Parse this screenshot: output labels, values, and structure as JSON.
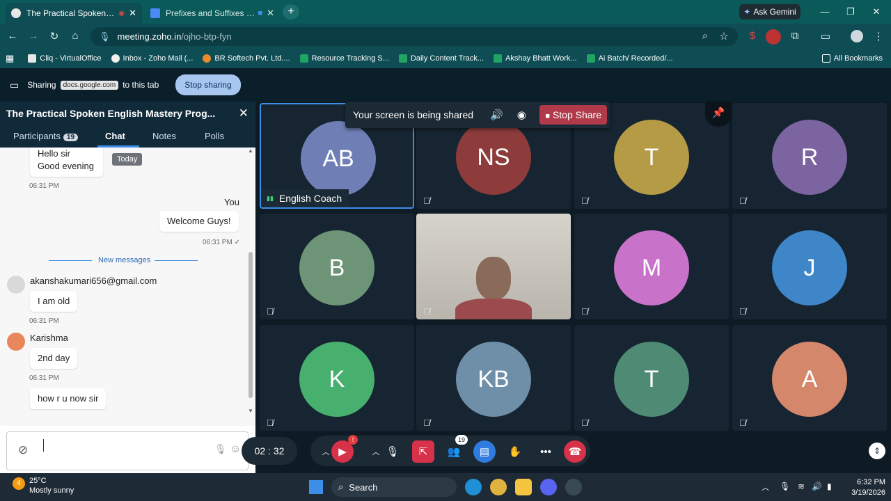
{
  "browser": {
    "tabs": [
      {
        "label": "The Practical Spoken English"
      },
      {
        "label": "Prefixes and Suffixes - Goo"
      }
    ],
    "gemini_label": "Ask Gemini",
    "url_host": "meeting.zoho.in",
    "url_path": "/ojho-btp-fyn",
    "bookmarks": [
      {
        "label": "Cliq - VirtualOffice"
      },
      {
        "label": "Inbox - Zoho Mail (..."
      },
      {
        "label": "BR Softech Pvt. Ltd...."
      },
      {
        "label": "Resource Tracking S..."
      },
      {
        "label": "Daily Content Track..."
      },
      {
        "label": "Akshay Bhatt Work..."
      },
      {
        "label": "Ai Batch/ Recorded/..."
      }
    ],
    "all_bookmarks": "All Bookmarks"
  },
  "sharebar": {
    "sharing": "Sharing",
    "domain": "docs.google.com",
    "suffix": "to this tab",
    "stop_label": "Stop sharing"
  },
  "chat": {
    "title": "The Practical Spoken English Mastery Prog...",
    "tabs": {
      "participants": "Participants",
      "participants_count": "19",
      "chat": "Chat",
      "notes": "Notes",
      "polls": "Polls"
    },
    "today_label": "Today",
    "msg1_line1": "Hello sir",
    "msg1_line2": "Good evening",
    "msg1_time": "06:31 PM",
    "you_label": "You",
    "you_msg": "Welcome Guys!",
    "you_time": "06:31 PM ✓",
    "new_messages": "New messages",
    "sender2": "akanshakumari656@gmail.com",
    "msg2": "I am old",
    "msg2_time": "06:31 PM",
    "sender3": "Karishma",
    "msg3": "2nd day",
    "msg3_time": "06:31 PM",
    "msg4": "how r u now sir"
  },
  "meeting": {
    "share_notice": "Your screen is being shared",
    "stop_share": "Stop Share",
    "host_name": "English Coach",
    "tiles": [
      {
        "initials": "AB",
        "color": "#6f7fb5"
      },
      {
        "initials": "NS",
        "color": "#8e3b3b"
      },
      {
        "initials": "T",
        "color": "#b59b45"
      },
      {
        "initials": "R",
        "color": "#7b64a0"
      },
      {
        "initials": "B",
        "color": "#6e9478"
      },
      {
        "initials": "",
        "color": "#c9c5bd"
      },
      {
        "initials": "M",
        "color": "#c873c9"
      },
      {
        "initials": "J",
        "color": "#3f86c8"
      },
      {
        "initials": "K",
        "color": "#48b06f"
      },
      {
        "initials": "KB",
        "color": "#6f8fa8"
      },
      {
        "initials": "T",
        "color": "#4e8a74"
      },
      {
        "initials": "A",
        "color": "#d4876a"
      }
    ],
    "timer": "02 : 32",
    "video_badge": "!",
    "participants_badge": "19"
  },
  "taskbar": {
    "temp": "25°C",
    "weather": "Mostly sunny",
    "weather_badge": "4",
    "search": "Search",
    "time": "6:32 PM",
    "date": "3/19/2026"
  }
}
